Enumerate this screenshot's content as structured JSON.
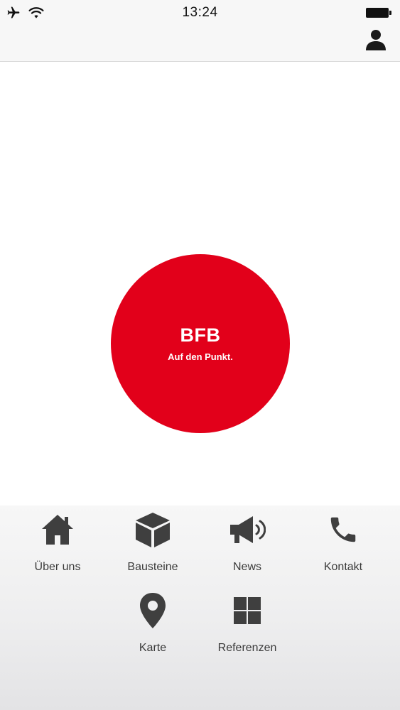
{
  "status_bar": {
    "time": "13:24",
    "icons": [
      "airplane-icon",
      "wifi-icon",
      "battery-icon"
    ]
  },
  "header": {
    "profile_icon": "user-icon"
  },
  "logo": {
    "title": "BFB",
    "tagline": "Auf den Punkt.",
    "color": "#e2001a"
  },
  "nav": {
    "items": [
      {
        "label": "Über uns",
        "icon": "home-icon"
      },
      {
        "label": "Bausteine",
        "icon": "cube-icon"
      },
      {
        "label": "News",
        "icon": "megaphone-icon"
      },
      {
        "label": "Kontakt",
        "icon": "phone-icon"
      },
      {
        "label": "Karte",
        "icon": "map-pin-icon"
      },
      {
        "label": "Referenzen",
        "icon": "grid-icon"
      }
    ],
    "icon_color": "#3f3f3f"
  }
}
